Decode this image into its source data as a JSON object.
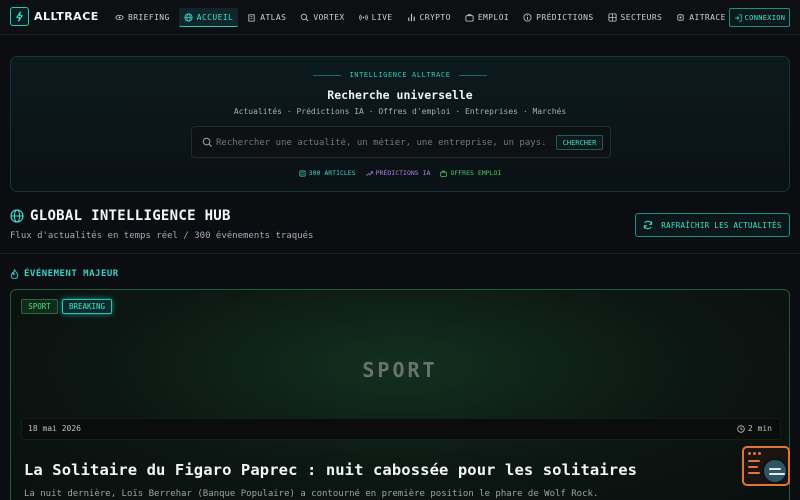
{
  "nav": {
    "brand": "ALLTRACE",
    "items": [
      {
        "label": "BRIEFING",
        "icon": "eye-icon"
      },
      {
        "label": "ACCUEIL",
        "icon": "globe-icon",
        "active": true
      },
      {
        "label": "ATLAS",
        "icon": "building-icon"
      },
      {
        "label": "VORTEX",
        "icon": "search-icon"
      },
      {
        "label": "LIVE",
        "icon": "broadcast-icon"
      },
      {
        "label": "CRYPTO",
        "icon": "bar-chart-icon"
      },
      {
        "label": "EMPLOI",
        "icon": "briefcase-icon"
      },
      {
        "label": "PRÉDICTIONS",
        "icon": "info-icon"
      },
      {
        "label": "SECTEURS",
        "icon": "grid-icon"
      },
      {
        "label": "AITRACE",
        "icon": "cpu-icon"
      },
      {
        "label": "",
        "icon": "map-icon"
      }
    ],
    "login": "CONNEXION"
  },
  "search": {
    "eyebrow": "INTELLIGENCE ALLTRACE",
    "title": "Recherche universelle",
    "subtitle": "Actualités · Prédictions IA · Offres d'emploi · Entreprises · Marchés",
    "placeholder": "Rechercher une actualité, un métier, une entreprise, un pays...",
    "button": "CHERCHER",
    "stats": [
      {
        "label": "300 ARTICLES",
        "color": "#3fd4c6",
        "icon": "newspaper-icon"
      },
      {
        "label": "PRÉDICTIONS IA",
        "color": "#b07ce8",
        "icon": "trend-icon"
      },
      {
        "label": "OFFRES EMPLOI",
        "color": "#45c96e",
        "icon": "briefcase-icon"
      }
    ]
  },
  "hub": {
    "title": "GLOBAL INTELLIGENCE HUB",
    "subtitle": "Flux d'actualités en temps réel / 300 événements traqués",
    "refresh": "RAFRAÎCHIR LES ACTUALITÉS"
  },
  "major": {
    "label": "ÉVÉNEMENT MAJEUR",
    "tags": [
      "SPORT",
      "BREAKING"
    ],
    "category": "SPORT",
    "date": "18 mai 2026",
    "read_time": "2 min",
    "headline": "La Solitaire du Figaro Paprec : nuit cabossée pour les solitaires",
    "excerpt": "La nuit dernière, Loïs Berrehar (Banque Populaire) a contourné en première position le phare de Wolf Rock."
  },
  "colors": {
    "accent": "#27c7bb",
    "sport": "#4be07a",
    "widget": "#e0743c"
  }
}
